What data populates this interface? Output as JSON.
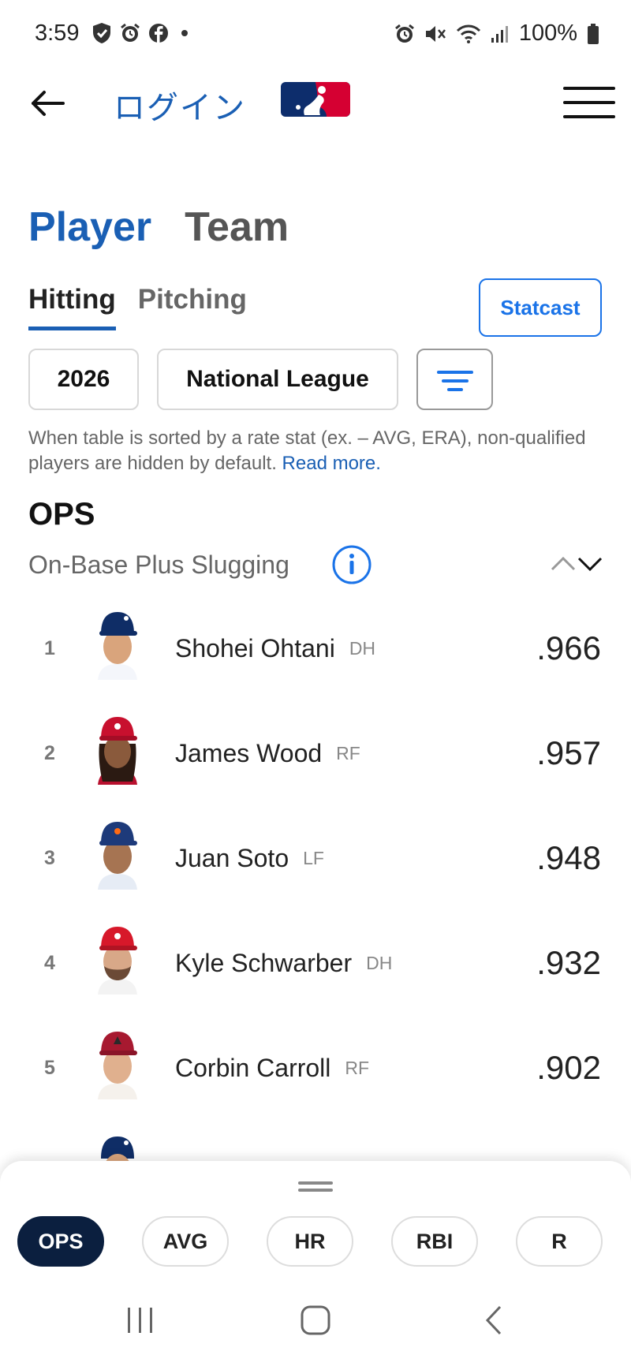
{
  "status_bar": {
    "time": "3:59",
    "battery": "100%",
    "left_icons": [
      "shield-icon",
      "alarm-icon",
      "facebook-icon",
      "dot-icon"
    ],
    "right_icons": [
      "alarm-icon",
      "mute-icon",
      "wifi-icon",
      "signal-icon",
      "battery-icon"
    ]
  },
  "header": {
    "login_label": "ログイン",
    "logo": "mlb-logo"
  },
  "main_tabs": [
    {
      "label": "Player",
      "active": true
    },
    {
      "label": "Team",
      "active": false
    }
  ],
  "sub_tabs": [
    {
      "label": "Hitting",
      "active": true
    },
    {
      "label": "Pitching",
      "active": false
    }
  ],
  "statcast_label": "Statcast",
  "filters": {
    "season": "2026",
    "league": "National League"
  },
  "note": {
    "text": "When table is sorted by a rate stat (ex. – AVG, ERA), non-qualified players are hidden by default.",
    "link": "Read more."
  },
  "stat": {
    "abbr": "OPS",
    "name": "On-Base Plus Slugging"
  },
  "leaders": [
    {
      "rank": "1",
      "name": "Shohei Ohtani",
      "pos": "DH",
      "value": ".966"
    },
    {
      "rank": "2",
      "name": "James Wood",
      "pos": "RF",
      "value": ".957"
    },
    {
      "rank": "3",
      "name": "Juan Soto",
      "pos": "LF",
      "value": ".948"
    },
    {
      "rank": "4",
      "name": "Kyle Schwarber",
      "pos": "DH",
      "value": ".932"
    },
    {
      "rank": "5",
      "name": "Corbin Carroll",
      "pos": "RF",
      "value": ".902"
    }
  ],
  "stat_chips": [
    {
      "label": "OPS",
      "active": true
    },
    {
      "label": "AVG",
      "active": false
    },
    {
      "label": "HR",
      "active": false
    },
    {
      "label": "RBI",
      "active": false
    },
    {
      "label": "R",
      "active": false
    }
  ],
  "colors": {
    "accent_blue": "#1a5fb4",
    "link_blue": "#1a73e8",
    "navy": "#0b1f3f",
    "mlb_red": "#d50032"
  }
}
